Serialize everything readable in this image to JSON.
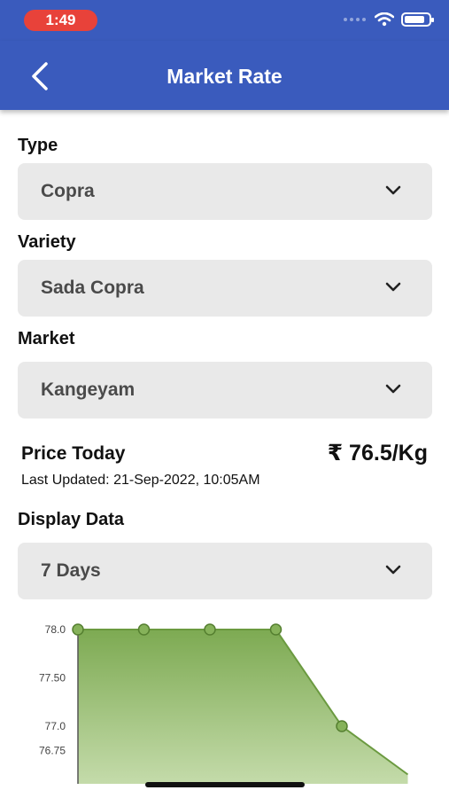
{
  "status_bar": {
    "time": "1:49",
    "icons": [
      "signal-dots-icon",
      "wifi-icon",
      "battery-icon"
    ]
  },
  "header": {
    "back_icon": "chevron-left-icon",
    "title": "Market Rate"
  },
  "form": {
    "type": {
      "label": "Type",
      "value": "Copra"
    },
    "variety": {
      "label": "Variety",
      "value": "Sada Copra"
    },
    "market": {
      "label": "Market",
      "value": "Kangeyam"
    },
    "display": {
      "label": "Display Data",
      "value": "7 Days"
    }
  },
  "price": {
    "label": "Price Today",
    "value": "₹ 76.5/Kg",
    "last_updated": "Last Updated: 21-Sep-2022, 10:05AM"
  },
  "colors": {
    "brand": "#3a5bbd",
    "status_pill": "#e8423a",
    "chart_fill_top": "#7daa52",
    "chart_fill_bottom": "#c4dbaa",
    "chart_line": "#6b9a40"
  },
  "chart_data": {
    "type": "area",
    "y_ticks": [
      "78.0",
      "77.50",
      "77.0",
      "76.75"
    ],
    "ylim": [
      76.75,
      78.0
    ],
    "x": [
      1,
      2,
      3,
      4,
      5,
      6
    ],
    "values": [
      78.0,
      78.0,
      78.0,
      78.0,
      77.0,
      76.5
    ],
    "markers_shown": [
      true,
      true,
      true,
      true,
      true,
      false
    ],
    "grid": false,
    "title": "",
    "xlabel": "",
    "ylabel": ""
  }
}
